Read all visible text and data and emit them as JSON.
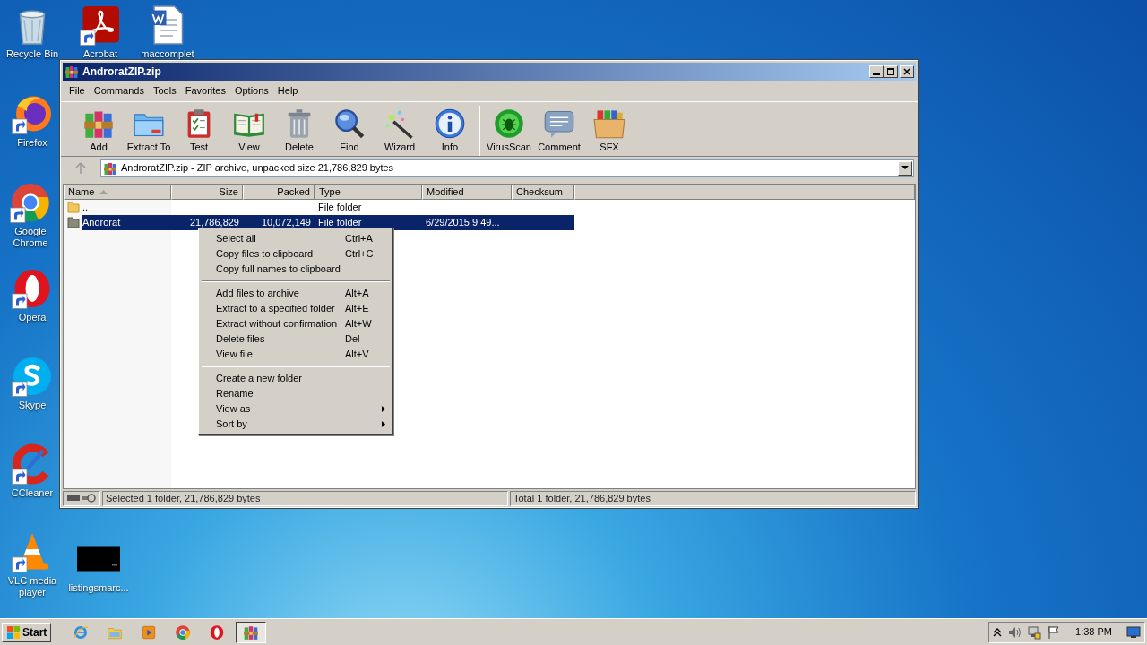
{
  "desktop_icons": [
    {
      "label": "Recycle Bin",
      "kind": "recycle",
      "shortcut": false
    },
    {
      "label": "Acrobat",
      "kind": "pdf",
      "shortcut": true
    },
    {
      "label": "maccomplet",
      "kind": "document",
      "shortcut": false
    },
    {
      "label": "Firefox",
      "kind": "firefox",
      "shortcut": true
    },
    {
      "label": "Google Chrome",
      "kind": "chrome",
      "shortcut": true
    },
    {
      "label": "Opera",
      "kind": "opera",
      "shortcut": true
    },
    {
      "label": "Skype",
      "kind": "skype",
      "shortcut": true
    },
    {
      "label": "CCleaner",
      "kind": "ccleaner",
      "shortcut": true
    },
    {
      "label": "VLC media player",
      "kind": "vlc",
      "shortcut": true
    },
    {
      "label": "listingsmarc...",
      "kind": "thumbnail",
      "shortcut": false
    }
  ],
  "window": {
    "title": "AndroratZIP.zip",
    "menu": [
      "File",
      "Commands",
      "Tools",
      "Favorites",
      "Options",
      "Help"
    ],
    "toolbar": [
      {
        "label": "Add",
        "kind": "books"
      },
      {
        "label": "Extract To",
        "kind": "folder"
      },
      {
        "label": "Test",
        "kind": "clipboard"
      },
      {
        "label": "View",
        "kind": "book"
      },
      {
        "label": "Delete",
        "kind": "trash"
      },
      {
        "label": "Find",
        "kind": "magnifier"
      },
      {
        "label": "Wizard",
        "kind": "wand"
      },
      {
        "label": "Info",
        "kind": "info"
      },
      {
        "label": "VirusScan",
        "kind": "bug"
      },
      {
        "label": "Comment",
        "kind": "speech"
      },
      {
        "label": "SFX",
        "kind": "box"
      }
    ],
    "address": "AndroratZIP.zip - ZIP archive, unpacked size 21,786,829 bytes",
    "columns": [
      {
        "label": "Name",
        "sorted": true
      },
      {
        "label": "Size",
        "sorted": false
      },
      {
        "label": "Packed",
        "sorted": false
      },
      {
        "label": "Type",
        "sorted": false
      },
      {
        "label": "Modified",
        "sorted": false
      },
      {
        "label": "Checksum",
        "sorted": false
      }
    ],
    "rows": [
      {
        "name": "..",
        "size": "",
        "packed": "",
        "type": "File folder",
        "modified": "",
        "selected": false
      },
      {
        "name": "Androrat",
        "size": "21,786,829",
        "packed": "10,072,149",
        "type": "File folder",
        "modified": "6/29/2015 9:49...",
        "selected": true
      }
    ],
    "status_left": "Selected 1 folder, 21,786,829 bytes",
    "status_right": "Total 1 folder, 21,786,829 bytes"
  },
  "context_menu": [
    [
      {
        "label": "Select all",
        "shortcut": "Ctrl+A",
        "submenu": false
      },
      {
        "label": "Copy files to clipboard",
        "shortcut": "Ctrl+C",
        "submenu": false
      },
      {
        "label": "Copy full names to clipboard",
        "submenu": false
      }
    ],
    [
      {
        "label": "Add files to archive",
        "shortcut": "Alt+A",
        "submenu": false
      },
      {
        "label": "Extract to a specified folder",
        "shortcut": "Alt+E",
        "submenu": false
      },
      {
        "label": "Extract without confirmation",
        "shortcut": "Alt+W",
        "submenu": false
      },
      {
        "label": "Delete files",
        "shortcut": "Del",
        "submenu": false
      },
      {
        "label": "View file",
        "shortcut": "Alt+V",
        "submenu": false
      }
    ],
    [
      {
        "label": "Create a new folder",
        "submenu": false
      },
      {
        "label": "Rename",
        "submenu": false
      },
      {
        "label": "View as",
        "submenu": true
      },
      {
        "label": "Sort by",
        "submenu": true
      }
    ]
  ],
  "taskbar": {
    "start": "Start",
    "items": [
      {
        "kind": "ie",
        "active": false
      },
      {
        "kind": "explorer",
        "active": false
      },
      {
        "kind": "media",
        "active": false
      },
      {
        "kind": "chrome",
        "active": false
      },
      {
        "kind": "opera",
        "active": false
      },
      {
        "kind": "winrar",
        "active": true
      }
    ],
    "clock": "1:38 PM"
  }
}
